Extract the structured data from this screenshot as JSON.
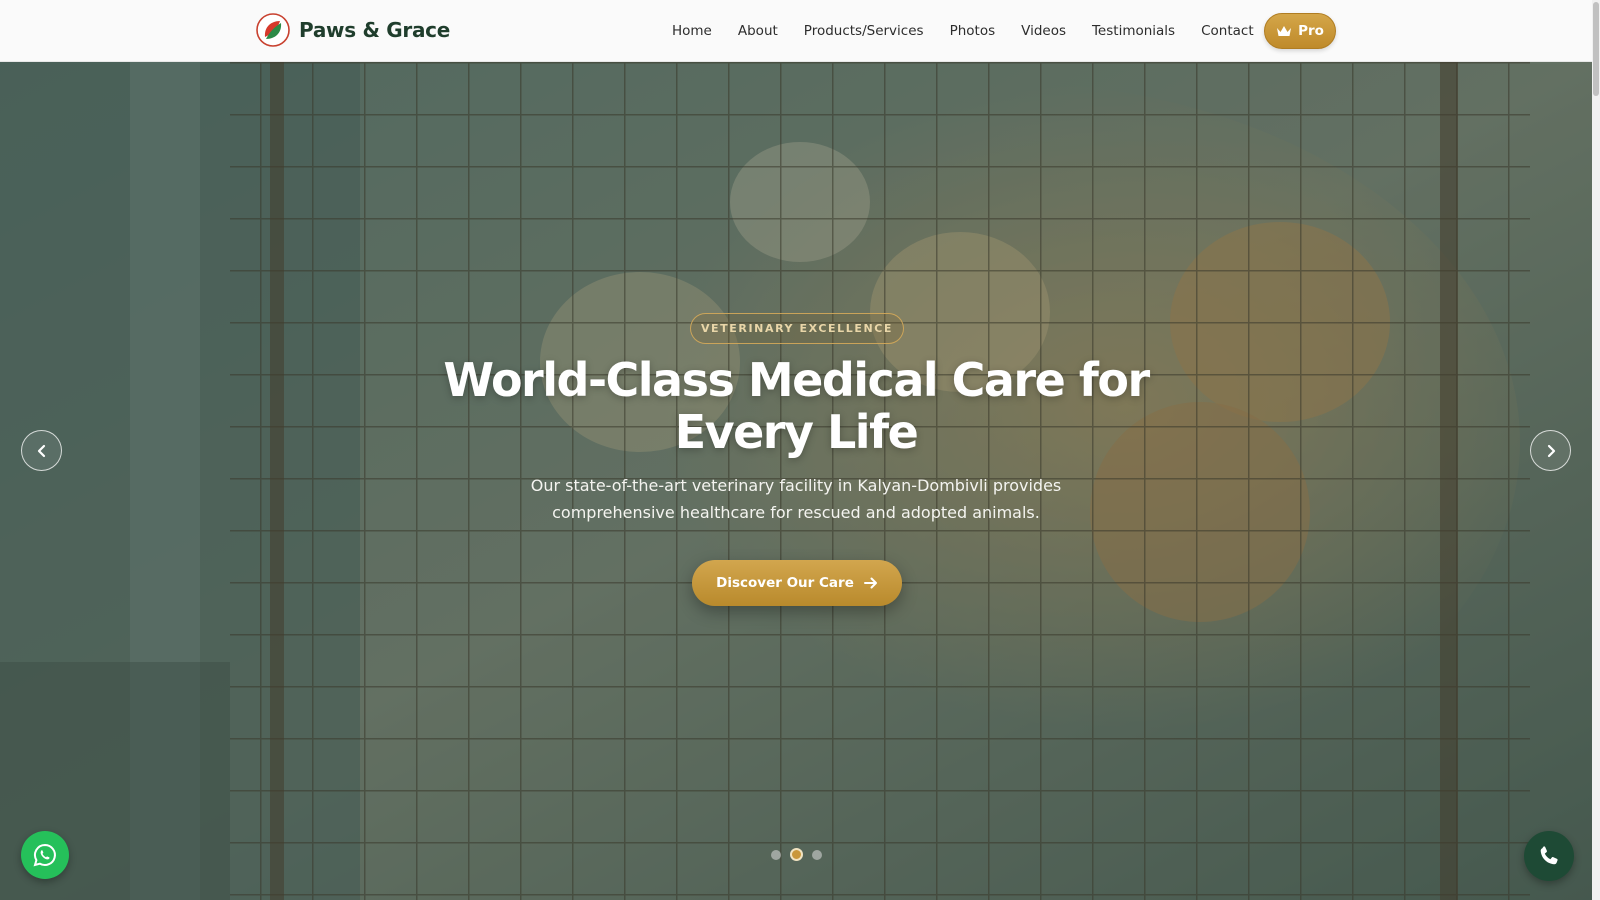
{
  "brand": {
    "name": "Paws & Grace",
    "logo_icon": "paw-leaf-logo-icon"
  },
  "nav": {
    "items": [
      {
        "label": "Home"
      },
      {
        "label": "About"
      },
      {
        "label": "Products/Services"
      },
      {
        "label": "Photos"
      },
      {
        "label": "Videos"
      },
      {
        "label": "Testimonials"
      },
      {
        "label": "Contact"
      }
    ],
    "pro_label": "Pro",
    "pro_icon": "crown-icon"
  },
  "hero": {
    "badge": "VETERINARY EXCELLENCE",
    "title": "World-Class Medical Care for Every Life",
    "subtitle": "Our state-of-the-art veterinary facility in Kalyan-Dombivli provides comprehensive healthcare for rescued and adopted animals.",
    "cta_label": "Discover Our Care",
    "cta_icon": "arrow-right-icon",
    "slides": {
      "count": 3,
      "active_index": 1
    }
  },
  "floating": {
    "whatsapp_icon": "whatsapp-icon",
    "phone_icon": "phone-icon"
  },
  "colors": {
    "brand_green": "#1f3d2c",
    "accent_gold": "#c9973b",
    "whatsapp_green": "#25c05a",
    "phone_bg": "#1e4a35"
  }
}
